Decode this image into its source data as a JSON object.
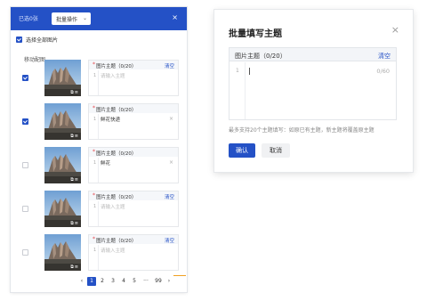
{
  "left_panel": {
    "header_label": "已选0张",
    "batch_select": "批量操作",
    "select_all": "选择全部图片",
    "section_title": "移动配图",
    "items": [
      {
        "checked": true,
        "title": "图片主题（0/20）",
        "clear": "清空",
        "num": "1",
        "text": "",
        "placeholder": "请输入主题",
        "has_remove": false
      },
      {
        "checked": true,
        "title": "图片主题（0/20）",
        "clear": "",
        "num": "1",
        "text": "鲜花快递",
        "placeholder": "",
        "has_remove": true
      },
      {
        "checked": false,
        "title": "图片主题（0/20）",
        "clear": "",
        "num": "1",
        "text": "鲜花",
        "placeholder": "",
        "has_remove": true
      },
      {
        "checked": false,
        "title": "图片主题（0/20）",
        "clear": "清空",
        "num": "1",
        "text": "",
        "placeholder": "请输入主题",
        "has_remove": false
      },
      {
        "checked": false,
        "title": "图片主题（0/20）",
        "clear": "清空",
        "num": "1",
        "text": "",
        "placeholder": "请输入主题",
        "has_remove": false
      }
    ],
    "pagination": {
      "prev": "‹",
      "pages": [
        "1",
        "2",
        "3",
        "4",
        "5",
        "···",
        "99"
      ],
      "current": "1",
      "next": "›"
    }
  },
  "dialog": {
    "title": "批量填写主题",
    "close": "×",
    "field_title": "图片主题（0/20）",
    "clear": "清空",
    "line_number": "1",
    "counter": "0/60",
    "hint": "最多支持20个主题填写：如原已有主题，新主题将覆盖原主题",
    "confirm": "确认",
    "cancel": "取消"
  },
  "colors": {
    "primary": "#2451c6",
    "required": "#e5484d"
  }
}
